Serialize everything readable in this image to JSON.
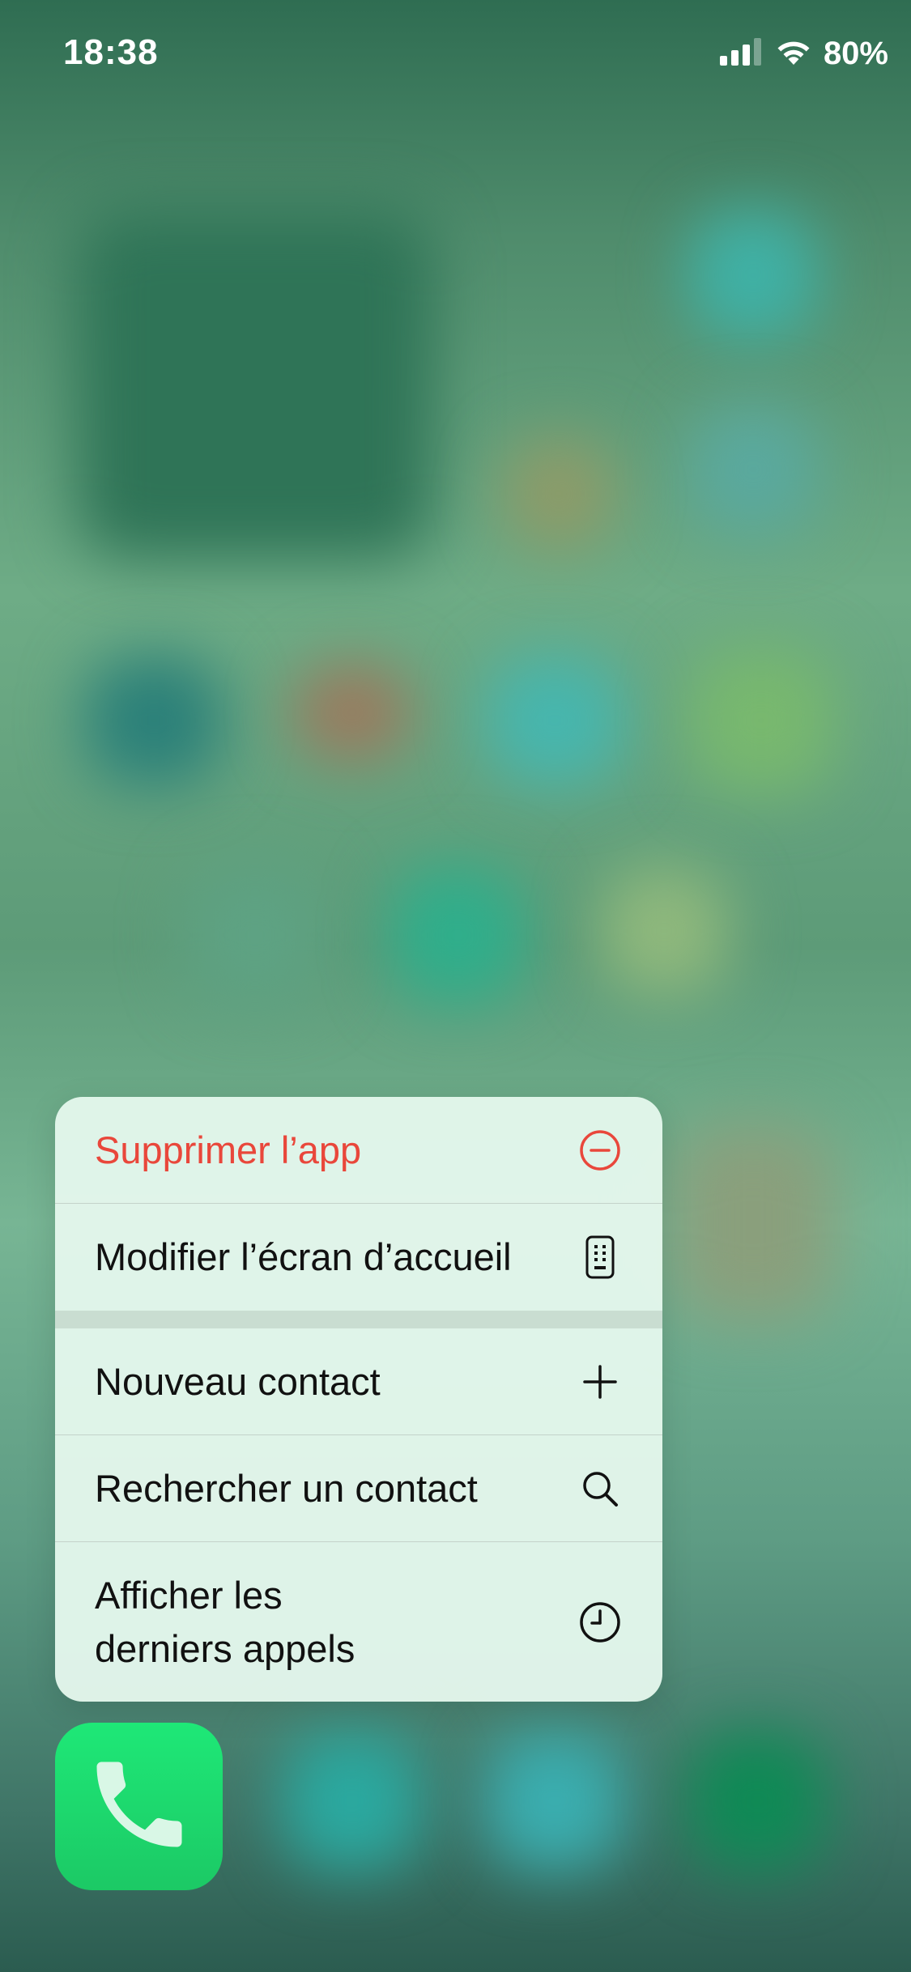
{
  "status_bar": {
    "time": "18:38",
    "battery_percent": "80%",
    "signal_bars_filled": 3,
    "signal_bars_total": 4
  },
  "menu": {
    "items": [
      {
        "label": "Supprimer l’app",
        "icon": "minus-circle-icon",
        "style": "destructive"
      },
      {
        "label": "Modifier l’écran d’accueil",
        "icon": "phone-grid-icon",
        "style": "default"
      },
      {
        "label": "Nouveau contact",
        "icon": "plus-icon",
        "style": "default"
      },
      {
        "label": "Rechercher un contact",
        "icon": "search-icon",
        "style": "default"
      },
      {
        "label": "Afficher les\nderniers appels",
        "icon": "clock-icon",
        "style": "default"
      }
    ]
  },
  "app": {
    "icon": "phone-handset-icon"
  },
  "colors": {
    "destructive": "#e9473b",
    "menu_background": "#e4f7ec",
    "phone_icon_green": "#1ee877"
  }
}
